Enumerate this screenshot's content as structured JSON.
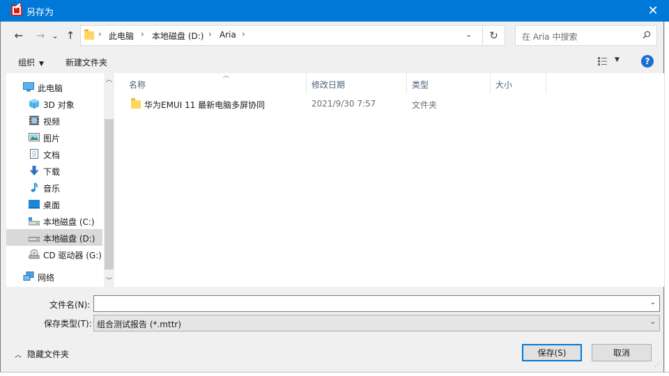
{
  "window": {
    "title": "另存为",
    "close_glyph": "✕"
  },
  "nav": {
    "back_glyph": "←",
    "forward_glyph": "→",
    "recent_glyph": "⌄",
    "up_glyph": "↑",
    "breadcrumbs": [
      "此电脑",
      "本地磁盘 (D:)",
      "Aria"
    ],
    "separator": "›",
    "dropdown_glyph": "⌄",
    "refresh_glyph": "↻",
    "search_placeholder": "在 Aria 中搜索"
  },
  "toolbar": {
    "organize": "组织",
    "new_folder": "新建文件夹",
    "caret": "▼",
    "help": "?"
  },
  "sidebar": {
    "items": [
      {
        "label": "此电脑",
        "icon": "computer-icon"
      },
      {
        "label": "3D 对象",
        "icon": "cube-icon"
      },
      {
        "label": "视频",
        "icon": "video-icon"
      },
      {
        "label": "图片",
        "icon": "picture-icon"
      },
      {
        "label": "文档",
        "icon": "document-icon"
      },
      {
        "label": "下载",
        "icon": "download-icon"
      },
      {
        "label": "音乐",
        "icon": "music-icon"
      },
      {
        "label": "桌面",
        "icon": "desktop-icon"
      },
      {
        "label": "本地磁盘 (C:)",
        "icon": "drive-c-icon"
      },
      {
        "label": "本地磁盘 (D:)",
        "icon": "drive-d-icon",
        "selected": true
      },
      {
        "label": "CD 驱动器 (G:)",
        "icon": "cd-drive-icon"
      },
      {
        "label": "网络",
        "icon": "network-icon"
      }
    ],
    "scroll_up": "︿",
    "scroll_down": "﹀"
  },
  "file_list": {
    "columns": [
      "名称",
      "修改日期",
      "类型",
      "大小"
    ],
    "sort_indicator": "︿",
    "rows": [
      {
        "name": "华为EMUI 11  最新电脑多屏协同",
        "modified": "2021/9/30 7:57",
        "type": "文件夹",
        "size": ""
      }
    ]
  },
  "form": {
    "filename_label": "文件名(N):",
    "filename_value": "",
    "filetype_label": "保存类型(T):",
    "filetype_value": "组合测试报告 (*.mttr)",
    "caret": "⌄"
  },
  "footer": {
    "hide_folders": "隐藏文件夹",
    "hide_caret": "︿",
    "save": "保存(S)",
    "cancel": "取消"
  },
  "colors": {
    "titlebar": "#0078d7",
    "selected_nav": "#d9d9d9",
    "folder": "#ffd75e",
    "help": "#1a6fd0"
  }
}
